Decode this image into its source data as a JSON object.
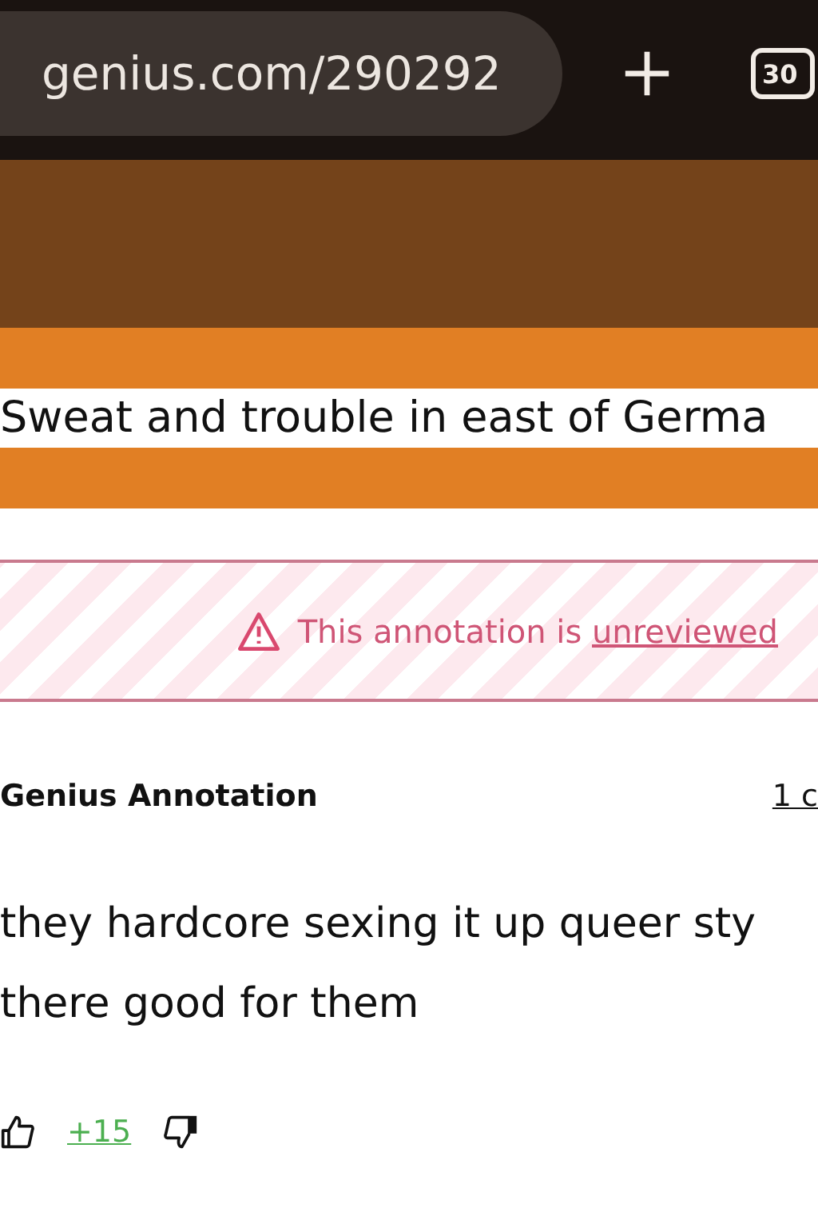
{
  "browser": {
    "url": "genius.com/290292",
    "tab_count": "30"
  },
  "song_title": "Sweat and trouble in east of Germa",
  "notice": {
    "text": "This annotation is ",
    "link": "unreviewed"
  },
  "annotation": {
    "label": "Genius Annotation",
    "comments": "1 c",
    "body": [
      "they hardcore sexing it up queer sty",
      "there good for them"
    ],
    "votes": "+15"
  }
}
